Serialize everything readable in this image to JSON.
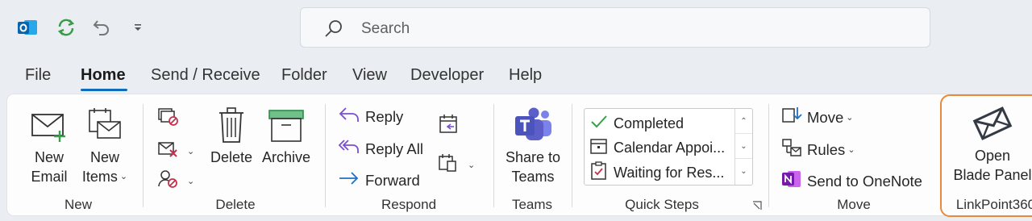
{
  "search": {
    "placeholder": "Search"
  },
  "quick_access": [
    {
      "icon": "outlook-icon"
    },
    {
      "icon": "sync-icon"
    },
    {
      "icon": "undo-icon"
    },
    {
      "icon": "customize-icon"
    }
  ],
  "tabs": [
    {
      "label": "File"
    },
    {
      "label": "Home",
      "active": true
    },
    {
      "label": "Send / Receive"
    },
    {
      "label": "Folder"
    },
    {
      "label": "View"
    },
    {
      "label": "Developer"
    },
    {
      "label": "Help"
    }
  ],
  "ribbon": {
    "new_group": {
      "label": "New",
      "new_email": [
        "New",
        "Email"
      ],
      "new_items": [
        "New",
        "Items"
      ]
    },
    "delete_group": {
      "label": "Delete",
      "delete": "Delete",
      "archive": "Archive"
    },
    "respond_group": {
      "label": "Respond",
      "reply": "Reply",
      "reply_all": "Reply All",
      "forward": "Forward"
    },
    "teams_group": {
      "label": "Teams",
      "share": [
        "Share to",
        "Teams"
      ]
    },
    "quick_steps": {
      "label": "Quick Steps",
      "items": [
        "Completed",
        "Calendar Appoi...",
        "Waiting for Res..."
      ]
    },
    "move_group": {
      "label": "Move",
      "move": "Move",
      "rules": "Rules",
      "onenote": "Send to OneNote"
    },
    "linkpoint": {
      "label": "LinkPoint360",
      "open": [
        "Open",
        "Blade Panel"
      ]
    }
  },
  "colors": {
    "accent": "#0f6cbd",
    "highlight_outline": "#e8893b",
    "teams": "#5b5fc7",
    "onenote": "#7719aa"
  }
}
